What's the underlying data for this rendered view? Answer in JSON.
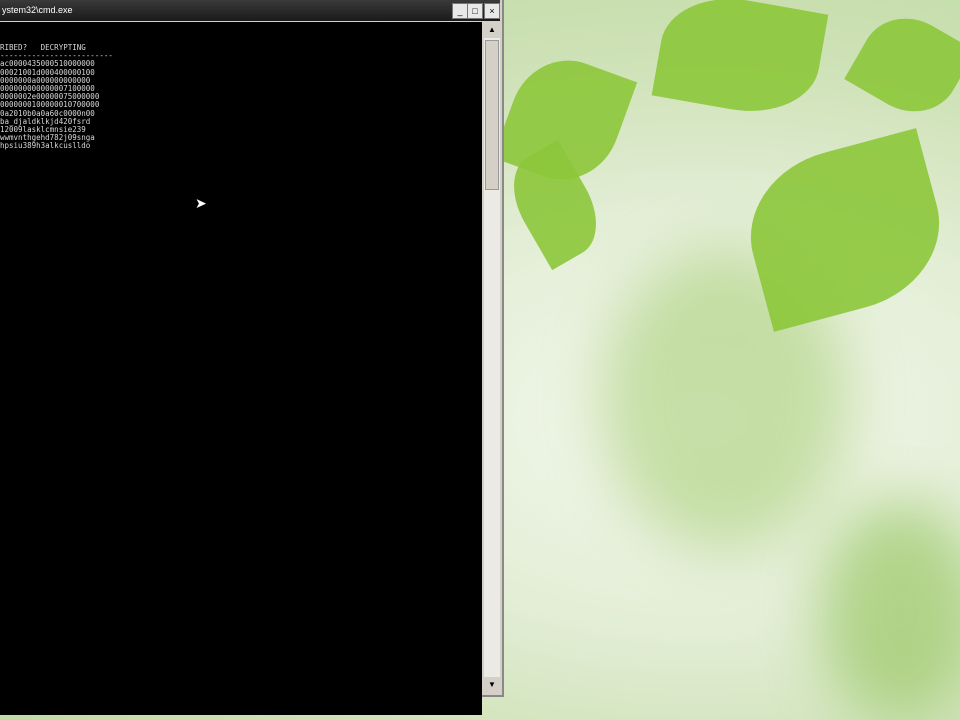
{
  "window": {
    "title": "ystem32\\cmd.exe",
    "min": "_",
    "max": "□",
    "close": "×"
  },
  "console": {
    "lines": [
      "RIBED?   DECRYPTING",
      "-------------------------",
      "ac0000435000510000000",
      "00021001d000400000100",
      "0000000a000000000000",
      "000000000000007100000",
      "0000002e00000075000000",
      "0000000100000010700000",
      "0a2010b0a0a60c0000n00",
      "ba_djaldklkjd420fsrd",
      "12009lasklcmnsie239",
      "wwmvnthgehd782j09snga",
      "hpsiu389h3alkcuslldo"
    ]
  },
  "scrollbar": {
    "up": "▲",
    "down": "▼"
  }
}
